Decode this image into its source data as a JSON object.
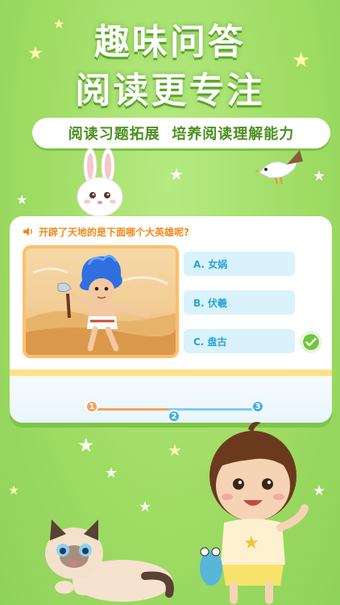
{
  "headline": {
    "line1": "趣味问答",
    "line2": "阅读更专注"
  },
  "subtitle": "阅读习题拓展  培养阅读理解能力",
  "quiz": {
    "question": "开辟了天地的是下面哪个大英雄呢?",
    "options": [
      {
        "label": "A. 女娲",
        "correct": false
      },
      {
        "label": "B. 伏羲",
        "correct": false
      },
      {
        "label": "C. 盘古",
        "correct": true
      }
    ],
    "steps": [
      "1",
      "2",
      "3"
    ],
    "current_step": 1
  },
  "colors": {
    "background": "#9fdc64",
    "headline_text": "#ffffff",
    "question_text": "#f08a1c",
    "option_bg": "#d9f2fb",
    "option_text": "#2aa4d6",
    "check": "#6cc93a",
    "step_active": "#f4a25b",
    "step_inactive": "#3db0e6"
  },
  "icons": {
    "speaker": "speaker-icon",
    "check": "check-icon",
    "stars": "star-icon"
  }
}
